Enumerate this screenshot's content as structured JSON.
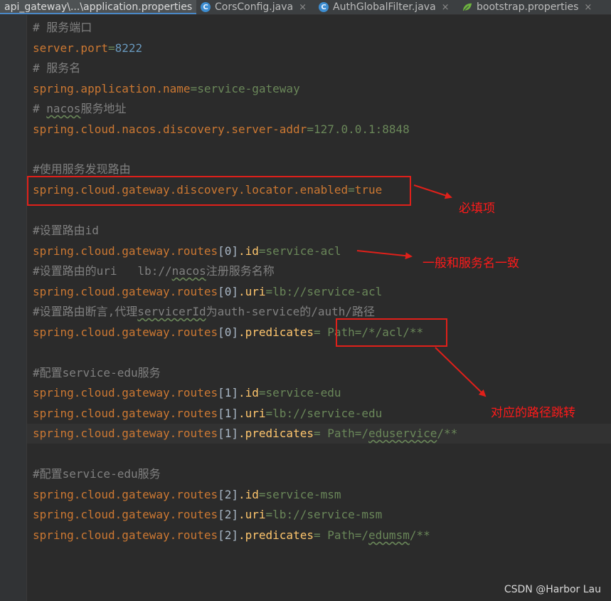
{
  "tabs": [
    {
      "label": "api_gateway\\...\\application.properties",
      "icon": "properties-file-icon",
      "active": true
    },
    {
      "label": "CorsConfig.java",
      "icon": "java-class-icon",
      "active": false
    },
    {
      "label": "AuthGlobalFilter.java",
      "icon": "java-class-icon",
      "active": false
    },
    {
      "label": "bootstrap.properties",
      "icon": "spring-leaf-icon",
      "active": false
    }
  ],
  "close_glyph": "×",
  "code": {
    "l1": "# 服务端口",
    "l2_key": "server.port",
    "l2_eq": "=",
    "l2_val": "8222",
    "l3": "# 服务名",
    "l4_key": "spring.application.name",
    "l4_eq": "=",
    "l4_val": "service-gateway",
    "l5_a": "# ",
    "l5_b": "nacos",
    "l5_c": "服务地址",
    "l6_key": "spring.cloud.nacos.discovery.server-addr",
    "l6_eq": "=",
    "l6_val": "127.0.0.1:8848",
    "l8": "#使用服务发现路由",
    "l9_key": "spring.cloud.gateway.discovery.locator.enabled",
    "l9_eq": "=",
    "l9_val": "true",
    "l11": "#设置路由id",
    "l12_prefix": "spring.cloud.gateway.routes",
    "l12_idx": "[0]",
    "l12_prop": ".id",
    "l12_eq": "=",
    "l12_val": "service-acl",
    "l13_a": "#设置路由的uri   lb://",
    "l13_b": "nacos",
    "l13_c": "注册服务名称",
    "l14_prefix": "spring.cloud.gateway.routes",
    "l14_idx": "[0]",
    "l14_prop": ".uri",
    "l14_eq": "=",
    "l14_val": "lb://service-acl",
    "l15_a": "#设置路由断言,代理",
    "l15_b": "servicerId",
    "l15_c": "为auth-service的/auth/路径",
    "l16_prefix": "spring.cloud.gateway.routes",
    "l16_idx": "[0]",
    "l16_prop": ".predicates",
    "l16_eq": "= ",
    "l16_val": "Path=/*/acl/**",
    "l18": "#配置service-edu服务",
    "l19_prefix": "spring.cloud.gateway.routes",
    "l19_idx": "[1]",
    "l19_prop": ".id",
    "l19_eq": "=",
    "l19_val": "service-edu",
    "l20_prefix": "spring.cloud.gateway.routes",
    "l20_idx": "[1]",
    "l20_prop": ".uri",
    "l20_eq": "=",
    "l20_val": "lb://service-edu",
    "l21_prefix": "spring.cloud.gateway.routes",
    "l21_idx": "[1]",
    "l21_prop": ".predicates",
    "l21_eq": "= ",
    "l21_val_a": "Path=/",
    "l21_val_b": "eduservice",
    "l21_val_c": "/**",
    "l23": "#配置service-edu服务",
    "l24_prefix": "spring.cloud.gateway.routes",
    "l24_idx": "[2]",
    "l24_prop": ".id",
    "l24_eq": "=",
    "l24_val": "service-msm",
    "l25_prefix": "spring.cloud.gateway.routes",
    "l25_idx": "[2]",
    "l25_prop": ".uri",
    "l25_eq": "=",
    "l25_val": "lb://service-msm",
    "l26_prefix": "spring.cloud.gateway.routes",
    "l26_idx": "[2]",
    "l26_prop": ".predicates",
    "l26_eq": "= ",
    "l26_val_a": "Path=/",
    "l26_val_b": "edumsm",
    "l26_val_c": "/**"
  },
  "annotations": {
    "required": "必填项",
    "same_as_service_name": "一般和服务名一致",
    "path_mapping": "对应的路径跳转"
  },
  "watermark": "CSDN @Harbor Lau",
  "colors": {
    "background": "#2b2b2b",
    "comment": "#808080",
    "key": "#cc7832",
    "property": "#ffc66d",
    "value": "#6a8759",
    "number": "#6897bb",
    "annotation": "#ff1a1a"
  }
}
